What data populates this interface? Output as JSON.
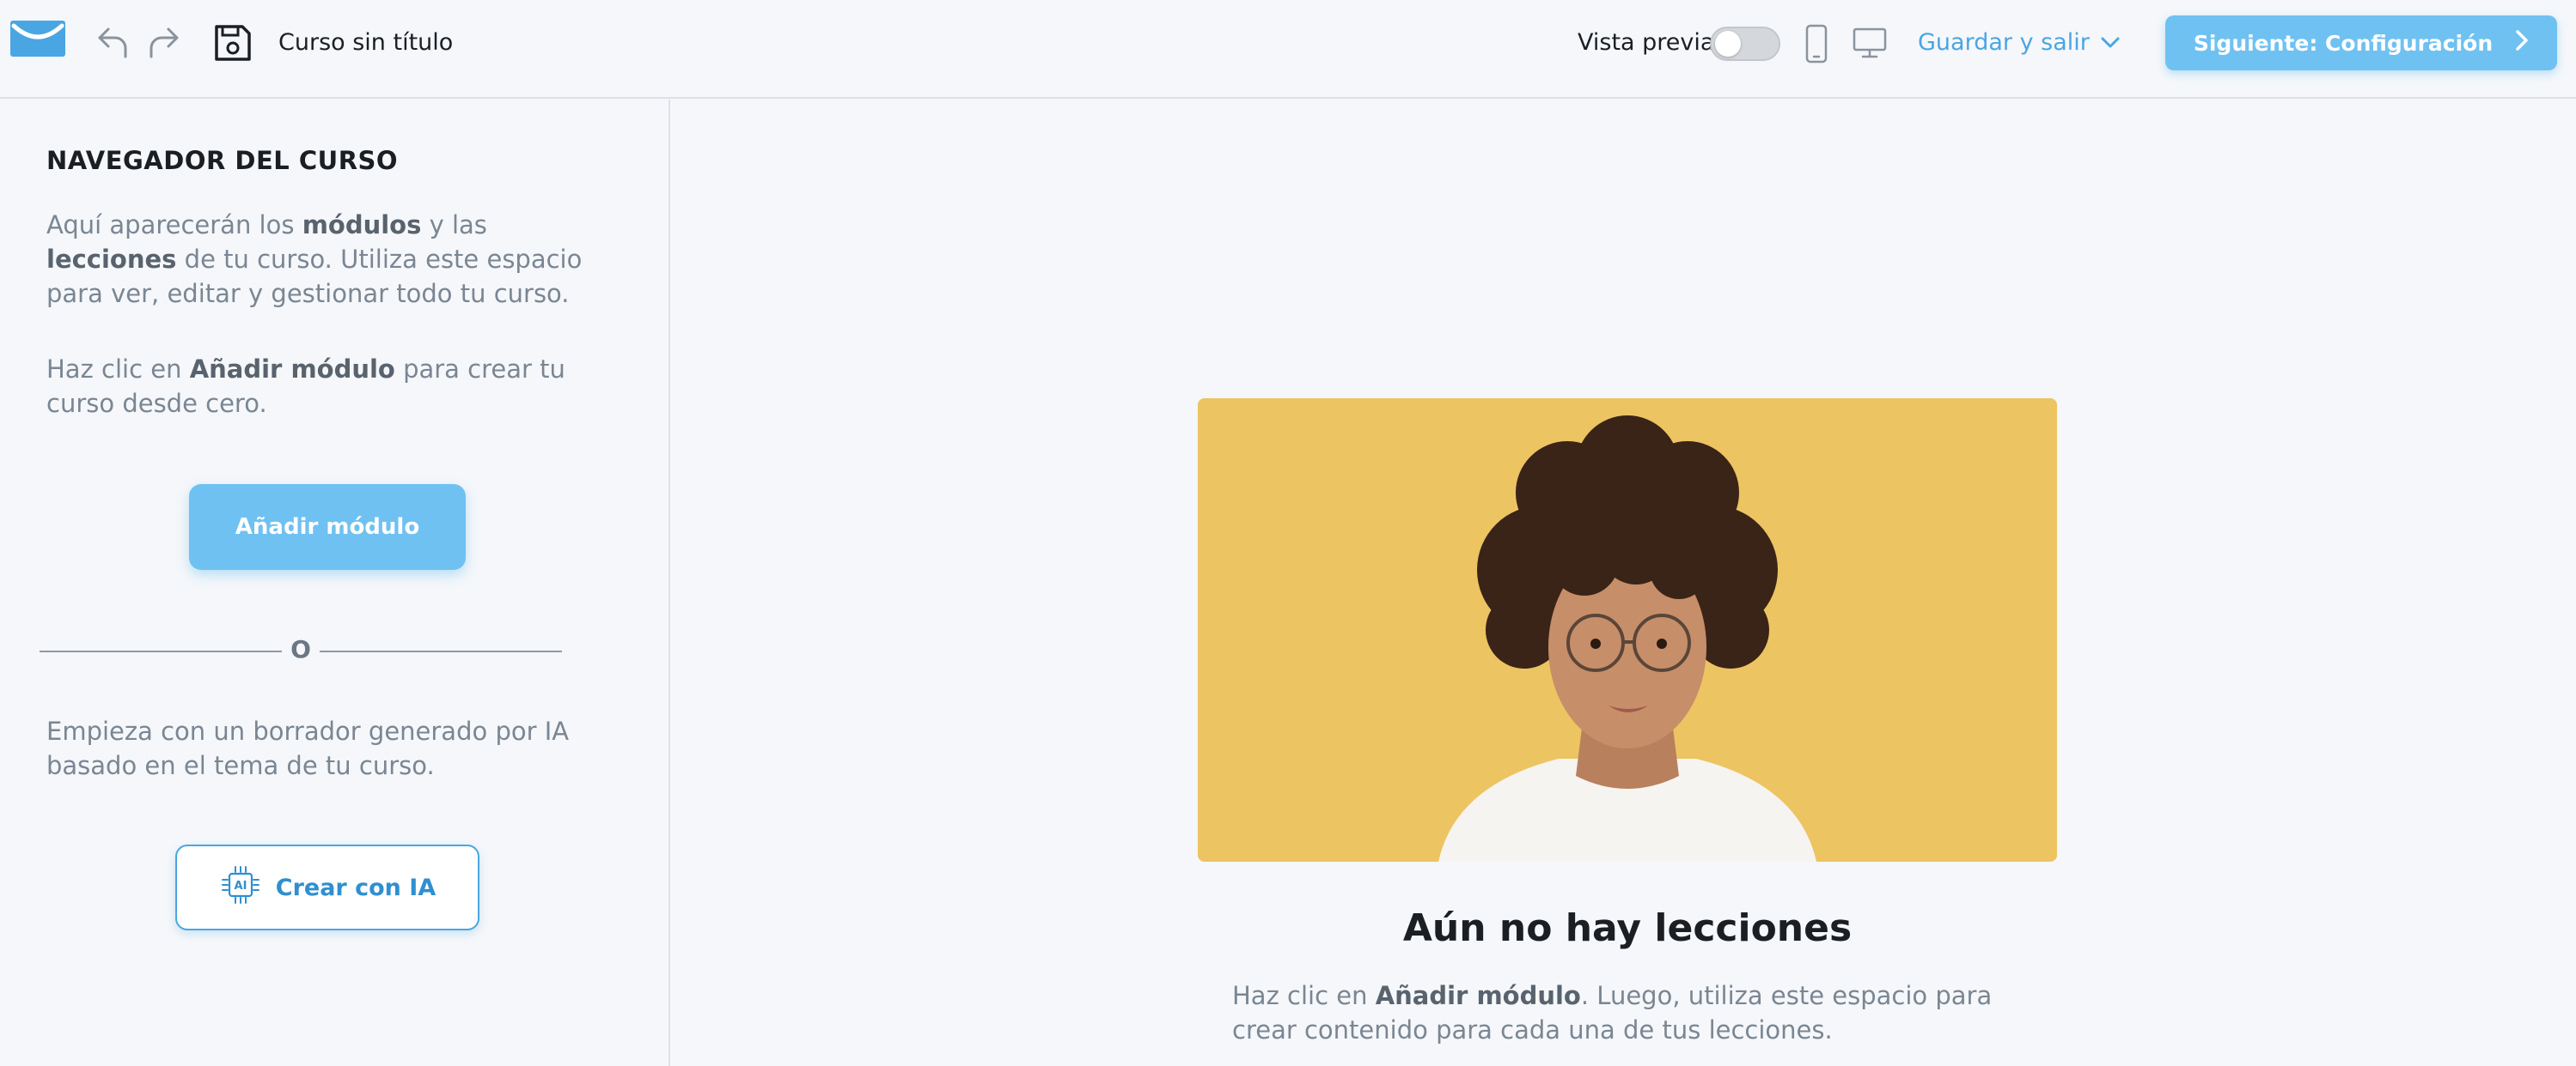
{
  "header": {
    "course_title": "Curso sin título",
    "preview_label": "Vista previa",
    "preview_enabled": false,
    "save_exit_label": "Guardar y salir",
    "next_label": "Siguiente: Configuración",
    "accent_color": "#4aa6e2",
    "primary_button_color": "#6fc1f2"
  },
  "sidebar": {
    "title": "NAVEGADOR DEL CURSO",
    "intro": {
      "t1": "Aquí aparecerán los ",
      "b1": "módulos",
      "t2": " y las ",
      "b2": "lecciones",
      "t3": " de tu curso. Utiliza este espacio para ver, editar y gestionar todo tu curso."
    },
    "hint": {
      "t1": "Haz clic en ",
      "b1": "Añadir módulo",
      "t2": " para crear tu curso desde cero."
    },
    "add_module_label": "Añadir módulo",
    "or_label": "O",
    "ai_text": "Empieza con un borrador generado por IA basado en el tema de tu curso.",
    "ai_button_label": "Crear con IA",
    "ai_icon_text": "AI"
  },
  "main": {
    "empty_title": "Aún no hay lecciones",
    "empty_desc": {
      "t1": "Haz clic en ",
      "b1": "Añadir módulo",
      "t2": ". Luego, utiliza este espacio para crear contenido para cada una de tus lecciones."
    }
  },
  "icons": {
    "logo": "envelope-logo-icon",
    "undo": "undo-icon",
    "redo": "redo-icon",
    "save": "save-icon",
    "phone": "mobile-preview-icon",
    "desktop": "desktop-preview-icon",
    "chevron_down": "chevron-down-icon",
    "chevron_right": "chevron-right-icon",
    "ai_chip": "ai-chip-icon"
  }
}
